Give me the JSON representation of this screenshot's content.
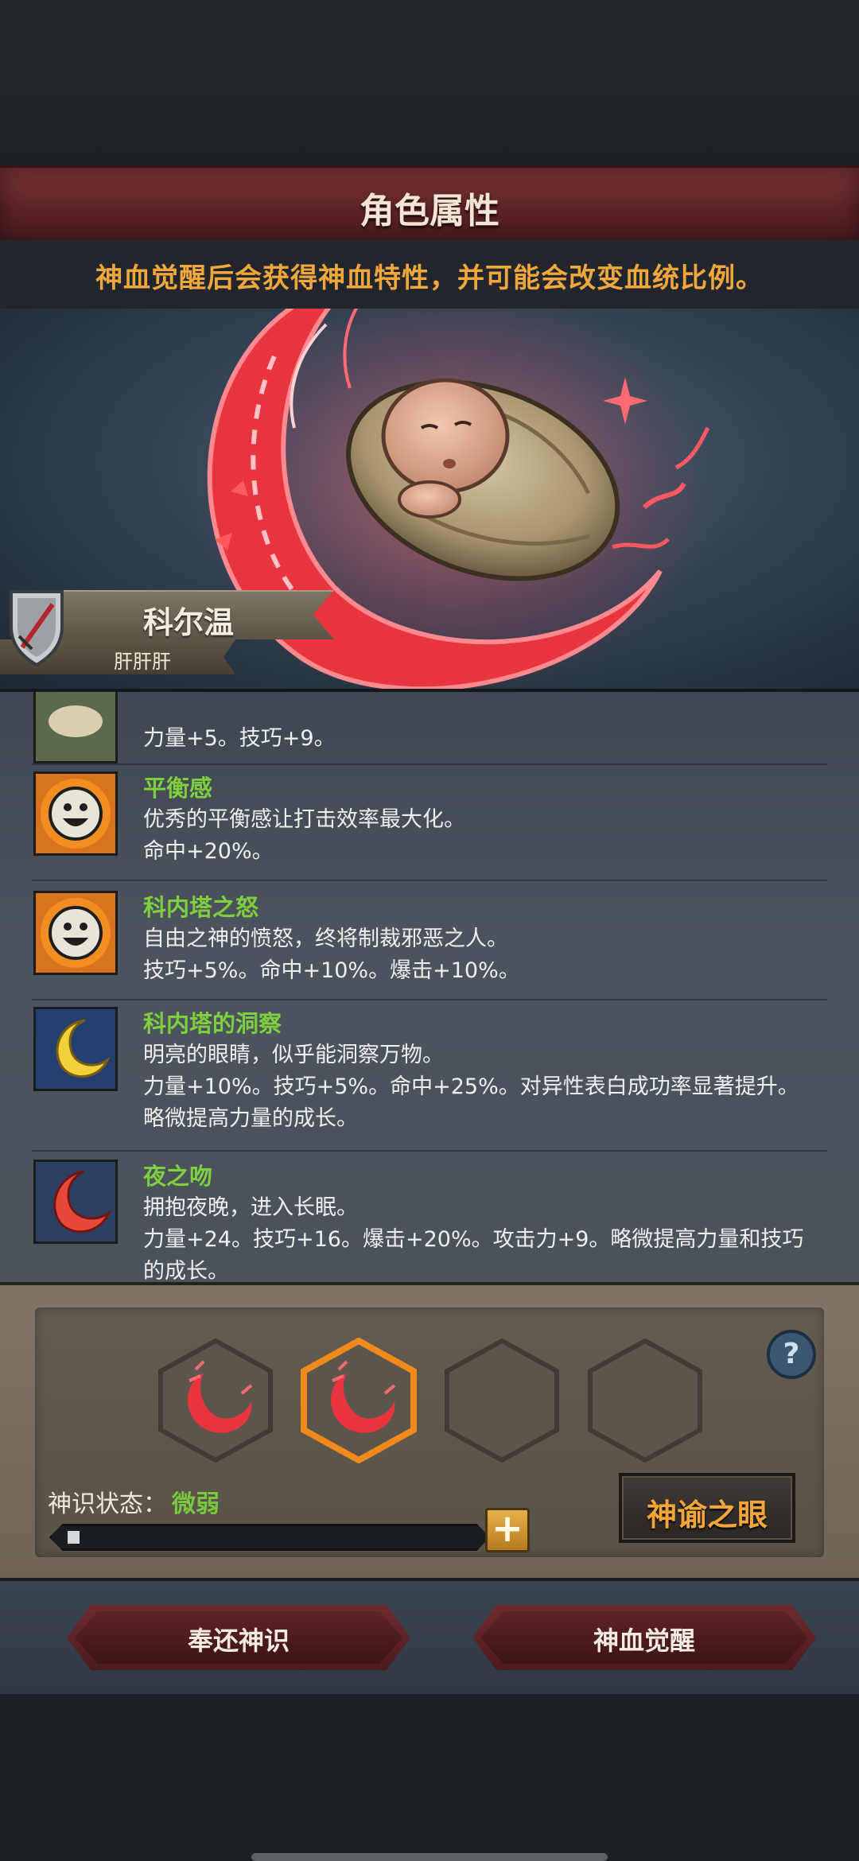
{
  "header": {
    "title": "角色属性",
    "hint": "神血觉醒后会获得神血特性，并可能会改变血统比例。"
  },
  "character": {
    "name": "科尔温",
    "subtitle": "肝肝肝"
  },
  "traits": [
    {
      "name": "",
      "desc": "",
      "effect": "力量+5。技巧+9。",
      "extra": "",
      "icon": "wheat-icon"
    },
    {
      "name": "平衡感",
      "desc": "优秀的平衡感让打击效率最大化。",
      "effect": "命中+20%。",
      "extra": "",
      "icon": "smiley-sun-icon"
    },
    {
      "name": "科内塔之怒",
      "desc": "自由之神的愤怒，终将制裁邪恶之人。",
      "effect": "技巧+5%。命中+10%。爆击+10%。",
      "extra": "",
      "icon": "smiley-sun-icon"
    },
    {
      "name": "科内塔的洞察",
      "desc": "明亮的眼睛，似乎能洞察万物。",
      "effect": "力量+10%。技巧+5%。命中+25%。对异性表白成功率显著提升。",
      "extra": "略微提高力量的成长。",
      "icon": "crescent-moon-icon"
    },
    {
      "name": "夜之吻",
      "desc": "拥抱夜晚，进入长眠。",
      "effect": "力量+24。技巧+16。爆击+20%。攻击力+9。略微提高力量和技巧",
      "extra": "的成长。",
      "icon": "red-moon-icon"
    }
  ],
  "awakening": {
    "state_label": "神识状态：",
    "state_value": "微弱",
    "progress": 0.03,
    "oracle_label": "神谕之眼",
    "help_label": "?",
    "plus_label": "+"
  },
  "actions": {
    "return_label": "奉还神识",
    "awaken_label": "神血觉醒"
  },
  "colors": {
    "trait_name": "#7fce3f",
    "hint": "#f0a83d",
    "accent_red": "#e8343f",
    "selected_slot": "#f08a1c"
  }
}
